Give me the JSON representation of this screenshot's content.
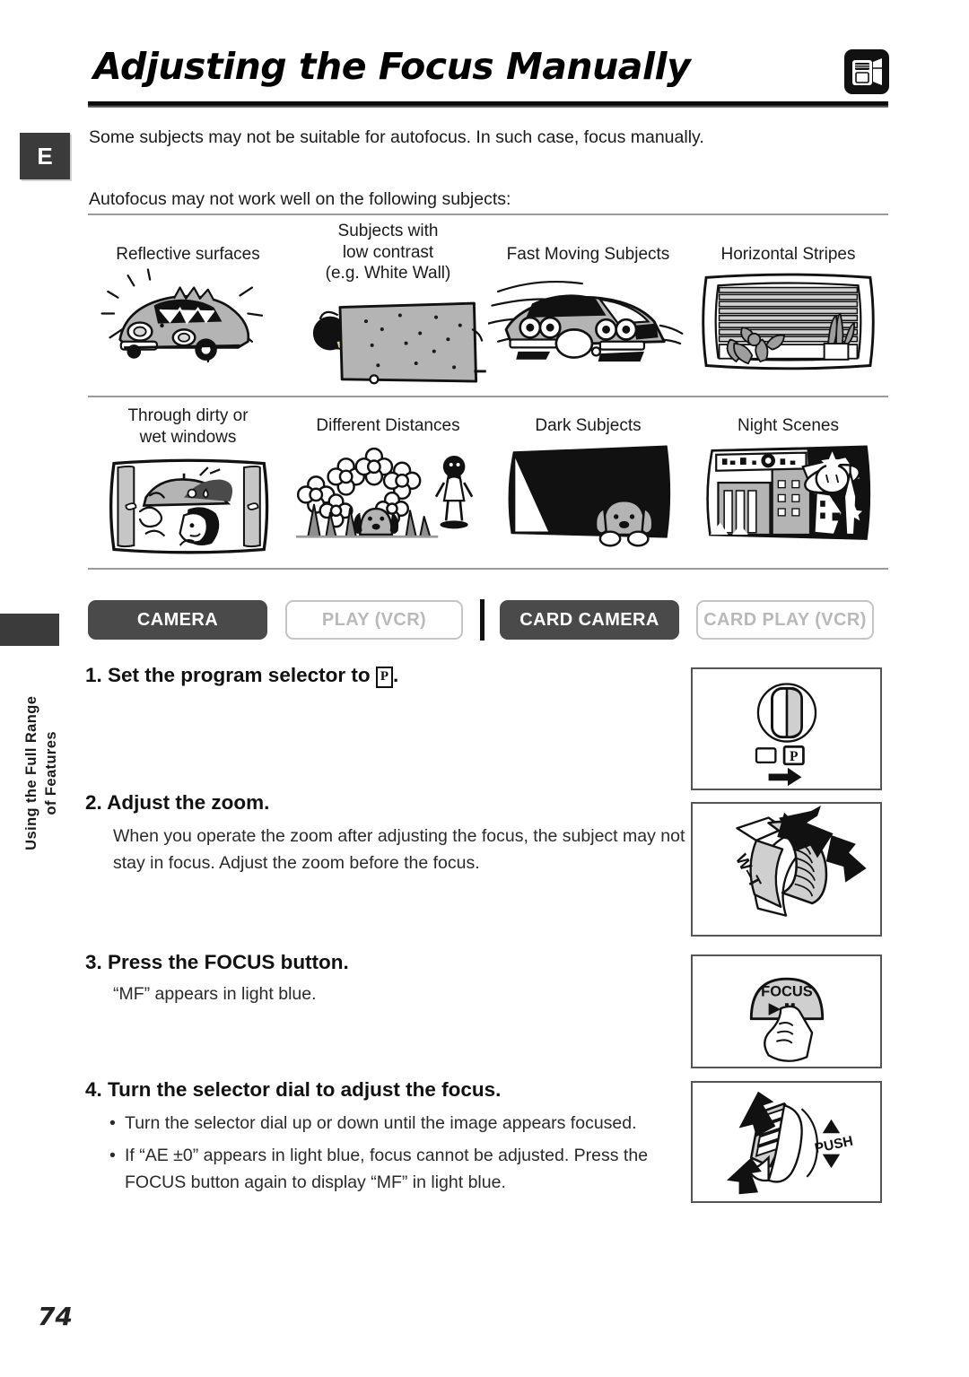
{
  "document": {
    "page_number": "74",
    "language_tab": "E",
    "chapter_label": "Using the Full Range\nof Features",
    "title": "Adjusting the Focus Manually",
    "header_icon": "camera-mode-icon"
  },
  "intro": {
    "paragraph": "Some subjects may not be suitable for autofocus. In such case, focus manually.",
    "subhead": "Autofocus may not work well on the following subjects:"
  },
  "subjects": {
    "row1": [
      {
        "label": "Reflective surfaces",
        "art": "reflective-car-illustration"
      },
      {
        "label": "Subjects with\nlow contrast\n(e.g. White Wall)",
        "art": "white-wall-illustration"
      },
      {
        "label": "Fast Moving Subjects",
        "art": "fast-car-illustration"
      },
      {
        "label": "Horizontal Stripes",
        "art": "window-blinds-illustration"
      }
    ],
    "row2": [
      {
        "label": "Through dirty or\nwet windows",
        "art": "wet-window-illustration"
      },
      {
        "label": "Different Distances",
        "art": "flowers-distance-illustration"
      },
      {
        "label": "Dark Subjects",
        "art": "dark-dog-illustration"
      },
      {
        "label": "Night Scenes",
        "art": "night-city-illustration"
      }
    ]
  },
  "modes": [
    {
      "label": "CAMERA",
      "state": "on"
    },
    {
      "label": "PLAY (VCR)",
      "state": "off"
    },
    {
      "label": "CARD CAMERA",
      "state": "on"
    },
    {
      "label": "CARD PLAY (VCR)",
      "state": "off"
    }
  ],
  "steps": {
    "step1": {
      "number": "1.",
      "head_before": "Set the program selector to ",
      "glyph": "P",
      "head_after": "."
    },
    "step2": {
      "head": "2. Adjust the zoom.",
      "body": "When you operate the zoom after adjusting the focus, the subject may not stay in focus. Adjust the zoom before the focus."
    },
    "step3": {
      "head": "3. Press the FOCUS button.",
      "body": "“MF” appears in light blue."
    },
    "step4": {
      "head": "4. Turn the selector dial to adjust the focus.",
      "bullets": [
        "Turn the selector dial up or down until the image appears focused.",
        "If “AE ±0” appears in light blue, focus cannot be adjusted. Press the FOCUS button again to display “MF” in light blue."
      ]
    }
  },
  "illustrations": [
    {
      "name": "program-selector-dial-illustration",
      "labels": [
        "P"
      ]
    },
    {
      "name": "zoom-lever-illustration",
      "labels": [
        "W",
        "T"
      ]
    },
    {
      "name": "focus-button-illustration",
      "labels": [
        "FOCUS"
      ]
    },
    {
      "name": "selector-dial-illustration",
      "labels": [
        "PUSH"
      ]
    }
  ],
  "colors": {
    "ink": "#1a1a1a",
    "badge_on_bg": "#4a4a4a",
    "badge_off_border": "#c4c4c4",
    "badge_off_text": "#b9b9b9",
    "tab_bg": "#3b3b3b",
    "art_gray": "#b0b0b0"
  }
}
